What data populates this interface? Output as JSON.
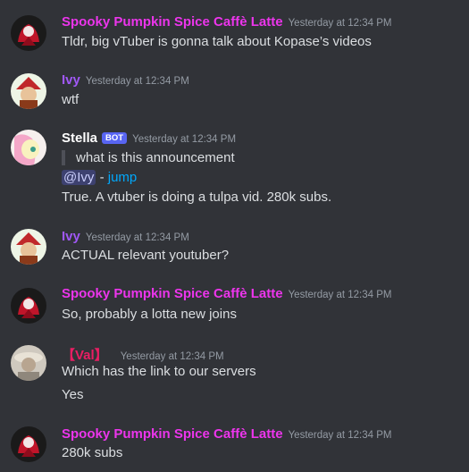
{
  "colors": {
    "spooky": "#ec35ec",
    "ivy": "#a058f5",
    "stella": "#ffffff",
    "val": "#e91e63"
  },
  "messages": [
    {
      "author": "Spooky Pumpkin Spice Caffè Latte",
      "timestamp": "Yesterday at 12:34 PM",
      "avatar": "spooky-avatar-icon",
      "lines": [
        "Tldr, big vTuber is gonna talk about Kopase’s videos"
      ]
    },
    {
      "author": "Ivy",
      "timestamp": "Yesterday at 12:34 PM",
      "avatar": "ivy-avatar-icon",
      "lines": [
        "wtf"
      ]
    },
    {
      "author": "Stella",
      "badge": "BOT",
      "timestamp": "Yesterday at 12:34 PM",
      "avatar": "stella-avatar-icon",
      "quote": "what is this announcement",
      "mention": "@Ivy",
      "mention_sep": " - ",
      "jump": "jump",
      "lines": [
        "True. A vtuber is doing a tulpa vid. 280k subs."
      ]
    },
    {
      "author": "Ivy",
      "timestamp": "Yesterday at 12:34 PM",
      "avatar": "ivy-avatar-icon",
      "lines": [
        "ACTUAL relevant youtuber?"
      ]
    },
    {
      "author": "Spooky Pumpkin Spice Caffè Latte",
      "timestamp": "Yesterday at 12:34 PM",
      "avatar": "spooky-avatar-icon",
      "lines": [
        "So, probably a lotta new joins"
      ]
    },
    {
      "author": "【Val】",
      "timestamp": "Yesterday at 12:34 PM",
      "avatar": "val-avatar-icon",
      "lines": [
        "Which has the link to our servers",
        "Yes"
      ]
    },
    {
      "author": "Spooky Pumpkin Spice Caffè Latte",
      "timestamp": "Yesterday at 12:34 PM",
      "avatar": "spooky-avatar-icon",
      "lines": [
        "280k subs"
      ]
    }
  ]
}
